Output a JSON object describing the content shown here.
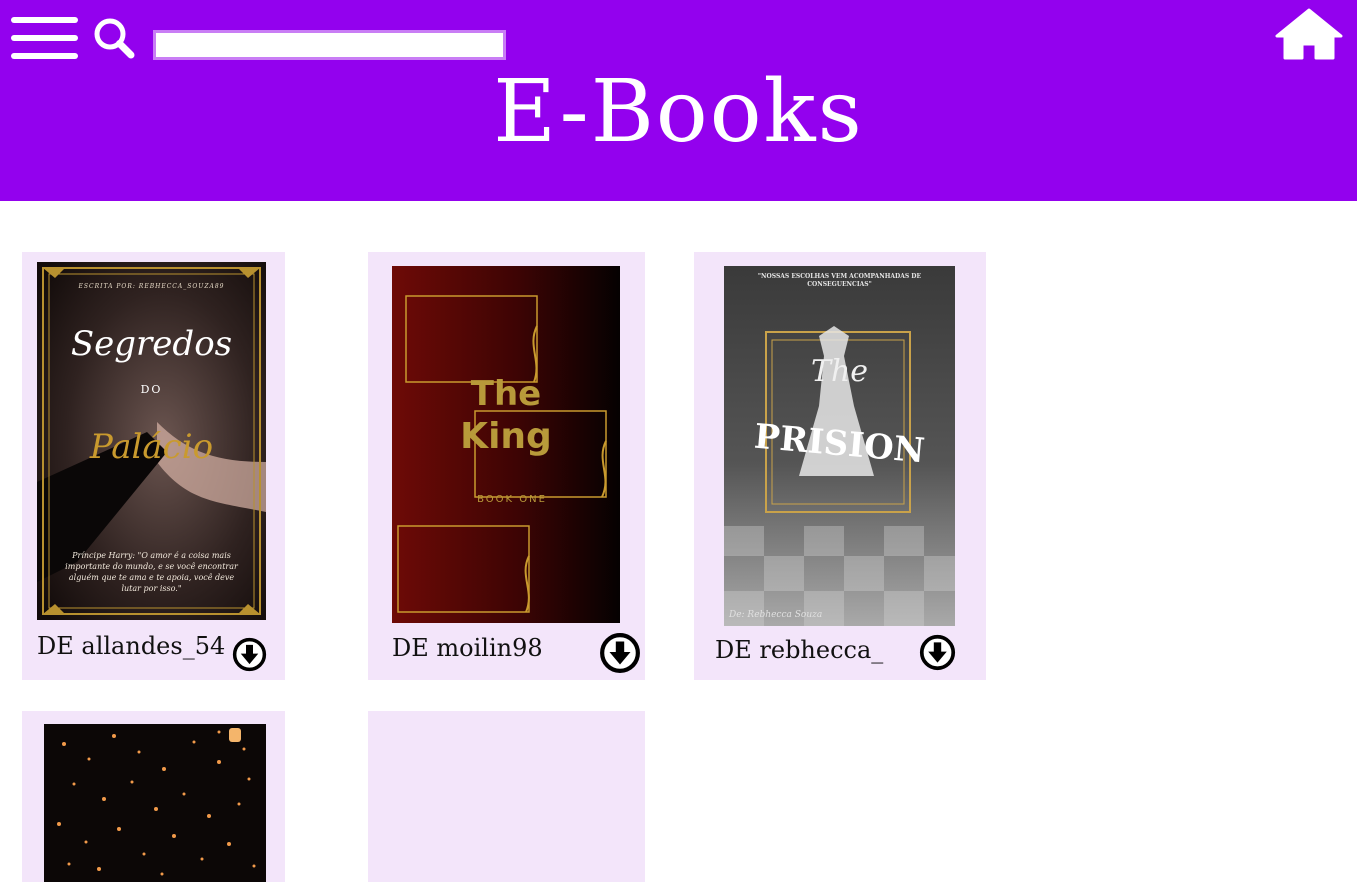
{
  "header": {
    "title": "E-Books",
    "background": "#9301ee",
    "search_placeholder": "",
    "menu_icon": "hamburger-menu-icon",
    "search_icon": "magnifier-icon",
    "home_icon": "house-icon"
  },
  "books": [
    {
      "author": "DE allandes_54",
      "cover": {
        "byline": "ESCRITA POR: REBHECCA_SOUZA89",
        "title_line1": "Segredos",
        "title_line2": "DO",
        "title_line3": "Palácio",
        "quote": "Príncipe Harry: \"O amor é a coisa mais importante do mundo, e se você encontrar alguém que te ama e te apoia, você deve lutar por isso.\""
      }
    },
    {
      "author": "DE moilin98",
      "cover": {
        "title_line1": "The",
        "title_line2": "King",
        "subtitle": "BOOK ONE"
      }
    },
    {
      "author": "DE rebhecca_",
      "cover": {
        "tagline": "\"NOSSAS ESCOLHAS VEM ACOMPANHADAS DE CONSEGUENCIAS\"",
        "title_line1": "The",
        "title_line2": "PRISION",
        "signature": "De: Rebhecca Souza"
      }
    }
  ],
  "download_icon": "download-arrow-circle-icon"
}
